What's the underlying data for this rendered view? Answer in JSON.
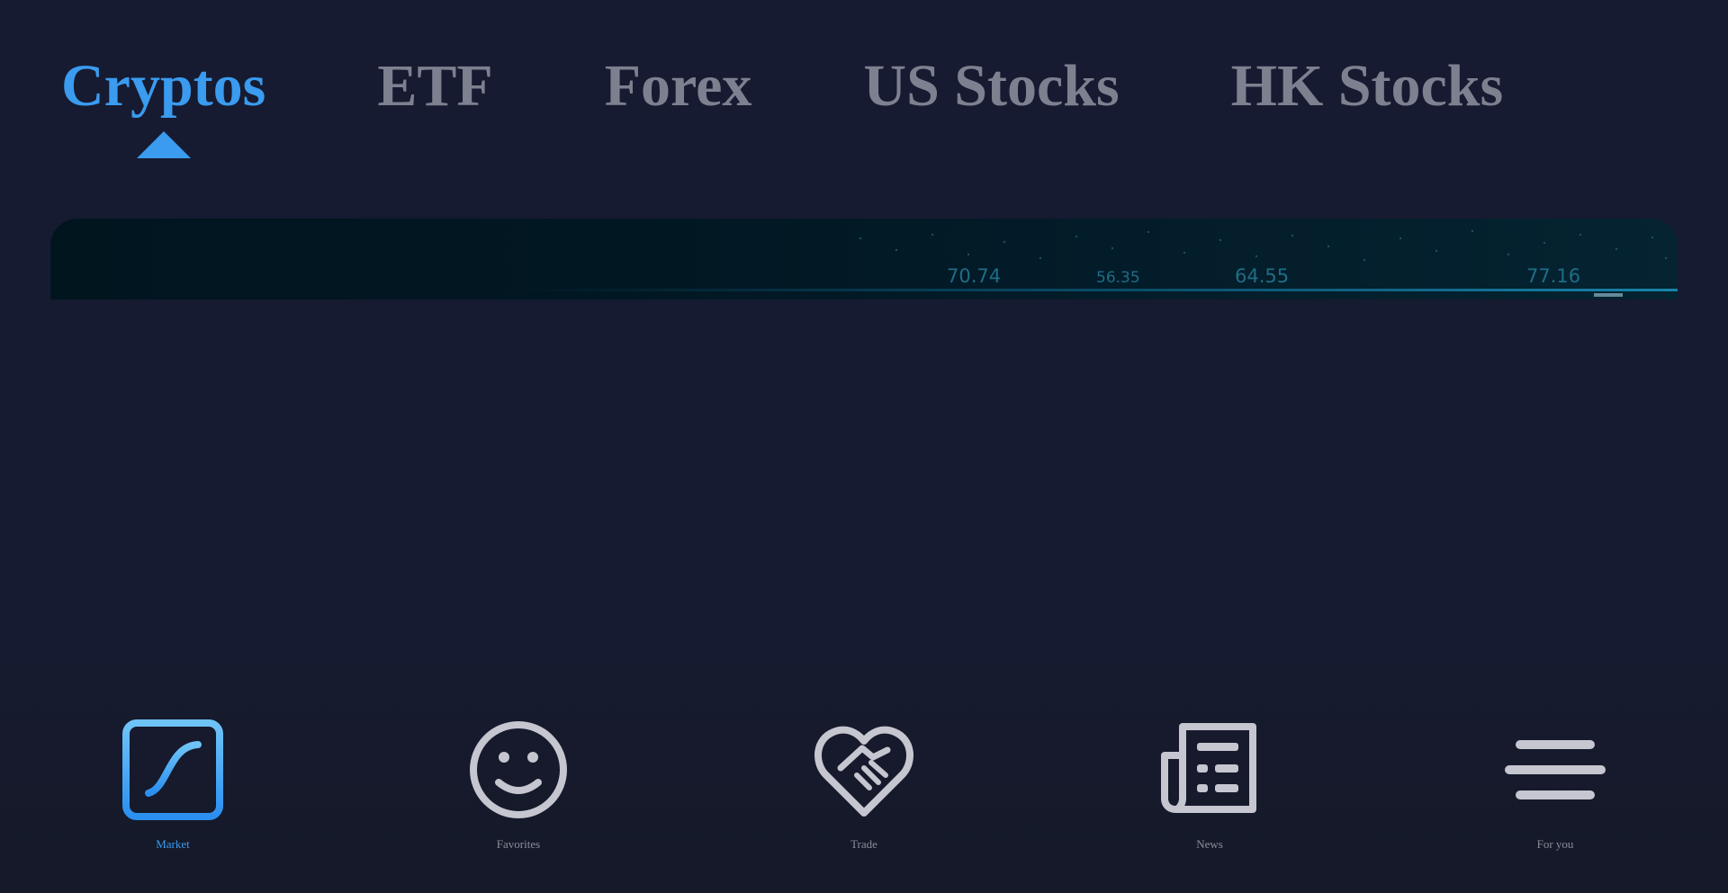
{
  "tabs": [
    {
      "label": "Cryptos",
      "active": true
    },
    {
      "label": "ETF",
      "active": false
    },
    {
      "label": "Forex",
      "active": false
    },
    {
      "label": "US Stocks",
      "active": false
    },
    {
      "label": "HK Stocks",
      "active": false
    }
  ],
  "banner": {
    "tickers": [
      "70.74",
      "56.35",
      "64.55",
      "77.16"
    ]
  },
  "bottom_nav": [
    {
      "label": "Market",
      "icon": "chart-line-icon",
      "active": true
    },
    {
      "label": "Favorites",
      "icon": "smiley-face-icon",
      "active": false
    },
    {
      "label": "Trade",
      "icon": "handshake-heart-icon",
      "active": false
    },
    {
      "label": "News",
      "icon": "newspaper-icon",
      "active": false
    },
    {
      "label": "For you",
      "icon": "menu-lines-icon",
      "active": false
    }
  ],
  "colors": {
    "background": "#161b31",
    "accent": "#3a9bef",
    "inactive_text": "#7d808f",
    "icon_gray": "#c5c6d0"
  }
}
